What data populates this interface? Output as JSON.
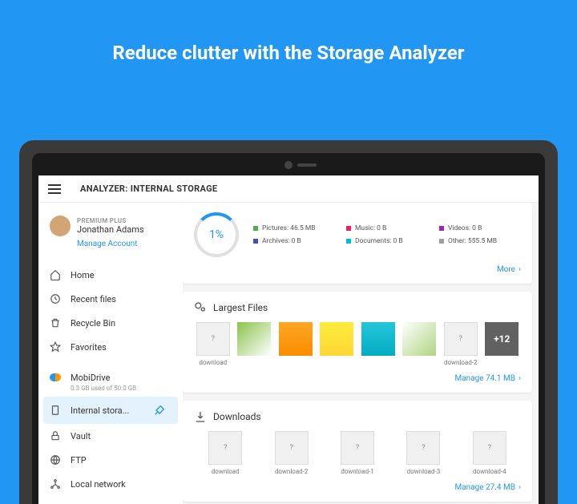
{
  "hero": {
    "title": "Reduce clutter with the Storage Analyzer"
  },
  "appbar": {
    "title": "ANALYZER: INTERNAL STORAGE"
  },
  "user": {
    "plan": "PREMIUM PLUS",
    "name": "Jonathan Adams",
    "manage": "Manage Account"
  },
  "nav": {
    "home": "Home",
    "recent": "Recent files",
    "recycle": "Recycle Bin",
    "favorites": "Favorites",
    "mobidrive": "MobiDrive",
    "mobidrive_sub": "0.3 GB used of 50.0 GB",
    "internal": "Internal stora...",
    "vault": "Vault",
    "ftp": "FTP",
    "local": "Local network"
  },
  "summary": {
    "percent": "1%",
    "legend": [
      {
        "label": "Pictures: 46.5 MB",
        "color": "#4caf50"
      },
      {
        "label": "Music: 0 B",
        "color": "#e91e63"
      },
      {
        "label": "Videos: 0 B",
        "color": "#9c27b0"
      },
      {
        "label": "Archives: 0 B",
        "color": "#3f51b5"
      },
      {
        "label": "Documents: 0 B",
        "color": "#00bcd4"
      },
      {
        "label": "Other: 555.5 MB",
        "color": "#9e9e9e"
      }
    ],
    "more": "More"
  },
  "largest": {
    "title": "Largest Files",
    "files": [
      "download",
      "",
      "",
      "",
      "",
      "",
      "download-2"
    ],
    "more_count": "+12",
    "manage": "Manage 74.1 MB"
  },
  "downloads": {
    "title": "Downloads",
    "files": [
      "download",
      "download-2",
      "download-1",
      "download-3",
      "download-4"
    ],
    "manage": "Manage 27.4 MB"
  },
  "chart_data": {
    "type": "pie",
    "title": "Internal Storage Usage",
    "used_percent": 1,
    "series": [
      {
        "name": "Pictures",
        "value": 46.5,
        "unit": "MB",
        "color": "#4caf50"
      },
      {
        "name": "Music",
        "value": 0,
        "unit": "B",
        "color": "#e91e63"
      },
      {
        "name": "Videos",
        "value": 0,
        "unit": "B",
        "color": "#9c27b0"
      },
      {
        "name": "Archives",
        "value": 0,
        "unit": "B",
        "color": "#3f51b5"
      },
      {
        "name": "Documents",
        "value": 0,
        "unit": "B",
        "color": "#00bcd4"
      },
      {
        "name": "Other",
        "value": 555.5,
        "unit": "MB",
        "color": "#9e9e9e"
      }
    ]
  }
}
